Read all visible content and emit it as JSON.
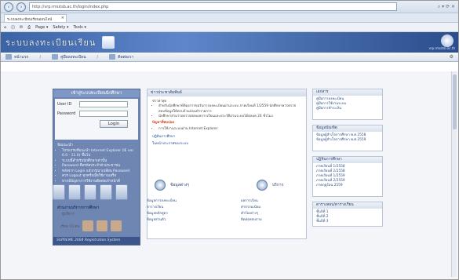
{
  "browser": {
    "address": "http://vrp.rmutsb.ac.th/login/index.php",
    "tab_title": "ระบบลงทะเบียนเรียนออนไลน์",
    "cmdbar": [
      "Page ▾",
      "Safety ▾",
      "Tools ▾"
    ],
    "addr_tools": "⌕ ▾ ⟳ ✕"
  },
  "site": {
    "title": "ระบบลงทะเบียนเรียน",
    "subtitle": "vrp.rmutsb.ac.th",
    "menu": [
      "หน้าแรก",
      "คู่มือลงทะเบียน",
      "ติดต่อเรา"
    ]
  },
  "login": {
    "head": "เข้าสู่ระบบทะเบียนนักศึกษา",
    "user_label": "User ID",
    "pass_label": "Password",
    "button": "Login",
    "notes": [
      "ข้อแนะนำ",
      "โปรแกรมที่แนะนำ Internet Explorer (IE ver 6.0 - 11.0) ขึ้นไป",
      "ระบบนี้สำหรับนักศึกษาเท่านั้น",
      "Password คือรหัสประจำตัวประชาชน",
      "หลังจาก Login แล้วกรุณาเปลี่ยน Password",
      "ควร Logout ทุกครั้งเมื่อใช้งานเสร็จ",
      "หากมีปัญหาการใช้งานติดต่อเจ้าหน้าที่"
    ],
    "foot": "SUPREME 2004 Registration System"
  },
  "news": {
    "head": "ข่าวประชาสัมพันธ์",
    "intro": "ข่าวล่าสุด",
    "items": [
      "สำหรับนักศึกษาที่ต้องการขอรับการลงทะเบียนผ่านระบบ ภาคเรียนที่ 1/2559 นักศึกษาควรตรวจสอบข้อมูลให้ครบถ้วนก่อนทำรายการ",
      "นักศึกษาสามารถตรวจสอบผลการเรียนและประวัติผ่านระบบได้ตลอด 24 ชั่วโมง"
    ],
    "sub": "ปัญหาที่พบบ่อย",
    "sub_items": [
      "การใช้งานระบบผ่าน Internet Explorer"
    ],
    "link1": "ปฏิทินการศึกษา",
    "link2": "ในหน้าประกาศของระบบ"
  },
  "sideboxes": [
    {
      "head": "เอกสาร",
      "lines": [
        "คู่มือการลงทะเบียน",
        "คู่มือการใช้งานระบบ",
        "คู่มือการชำระเงิน"
      ]
    },
    {
      "head": "ข้อมูลบัณฑิต",
      "lines": [
        "ข้อมูลผู้สำเร็จการศึกษา พ.ศ.2558",
        "ข้อมูลผู้สำเร็จการศึกษา พ.ศ.2559"
      ]
    },
    {
      "head": "ปฏิทินการศึกษา",
      "lines": [
        "ภาคเรียนที่ 1/2558",
        "ภาคเรียนที่ 2/2558",
        "ภาคเรียนที่ 1/2559",
        "ภาคเรียนที่ 2/2559",
        "ภาคฤดูร้อน 2559"
      ]
    },
    {
      "head": "ตารางสอบ/ตารางเรียน",
      "lines": [
        "ชั้นปีที่ 1",
        "ชั้นปีที่ 2",
        "ชั้นปีที่ 3"
      ]
    }
  ],
  "bottom": {
    "title": "ส่วนงานบริการการศึกษา",
    "subtitle": "ผู้บริหาร",
    "photos_label": "เรียน 10 คน",
    "svc1": "ข้อมูลต่างๆ",
    "svc2": "บริการ",
    "svc1_links": [
      "ข้อมูลการลงทะเบียน",
      "ตารางเรียน",
      "ข้อมูลหลักสูตร",
      "ข้อมูลส่วนตัว"
    ],
    "svc2_links": [
      "ผลการเรียน",
      "ค่าธรรมเนียม",
      "คำร้องต่างๆ",
      "ติดต่อสอบถาม"
    ]
  }
}
